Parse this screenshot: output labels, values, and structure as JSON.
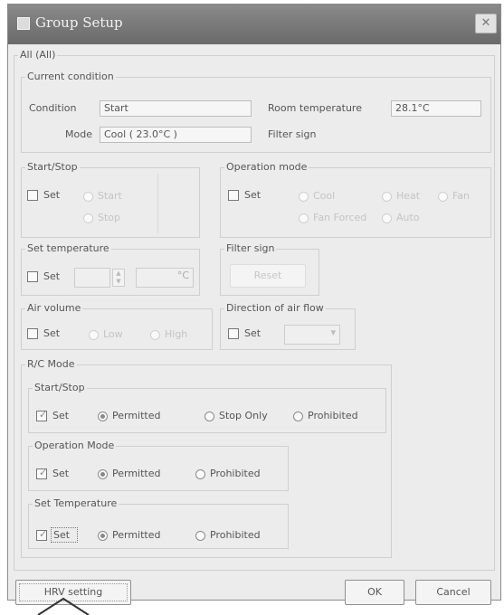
{
  "window": {
    "title": "Group Setup",
    "close_glyph": "✕",
    "group_name": "All (All)"
  },
  "current_condition": {
    "legend": "Current condition",
    "condition_label": "Condition",
    "condition_value": "Start",
    "room_temp_label": "Room temperature",
    "room_temp_value": "28.1°C",
    "mode_label": "Mode",
    "mode_value": "Cool ( 23.0°C )",
    "filter_sign_label": "Filter sign"
  },
  "start_stop": {
    "legend": "Start/Stop",
    "set_label": "Set",
    "option_start": "Start",
    "option_stop": "Stop"
  },
  "operation_mode": {
    "legend": "Operation mode",
    "set_label": "Set",
    "option_cool": "Cool",
    "option_heat": "Heat",
    "option_fan": "Fan",
    "option_fan_forced": "Fan Forced",
    "option_auto": "Auto"
  },
  "set_temperature": {
    "legend": "Set temperature",
    "set_label": "Set",
    "unit": "°C"
  },
  "filter_sign": {
    "legend": "Filter sign",
    "reset_label": "Reset"
  },
  "air_volume": {
    "legend": "Air volume",
    "set_label": "Set",
    "option_low": "Low",
    "option_high": "High"
  },
  "air_flow": {
    "legend": "Direction of air flow",
    "set_label": "Set"
  },
  "rc_mode": {
    "legend": "R/C Mode",
    "start_stop": {
      "legend": "Start/Stop",
      "set_label": "Set",
      "permitted": "Permitted",
      "stop_only": "Stop Only",
      "prohibited": "Prohibited"
    },
    "operation_mode": {
      "legend": "Operation Mode",
      "set_label": "Set",
      "permitted": "Permitted",
      "prohibited": "Prohibited"
    },
    "set_temperature": {
      "legend": "Set Temperature",
      "set_label": "Set",
      "permitted": "Permitted",
      "prohibited": "Prohibited"
    }
  },
  "buttons": {
    "hrv_setting": "HRV setting",
    "ok": "OK",
    "cancel": "Cancel"
  }
}
